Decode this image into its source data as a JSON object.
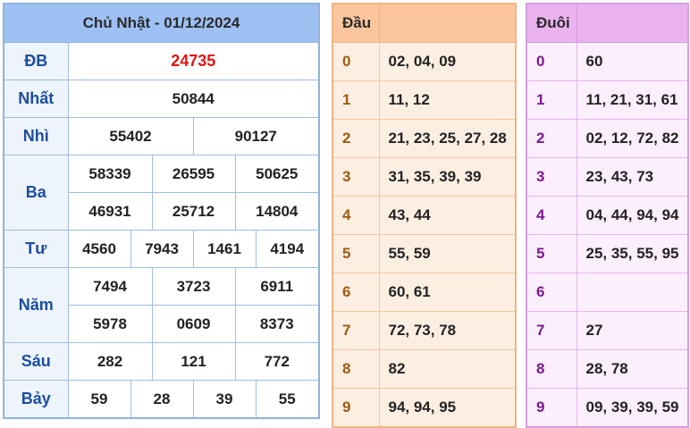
{
  "header": {
    "title": "Chủ Nhật - 01/12/2024"
  },
  "prizes": {
    "db": {
      "label": "ĐB",
      "values": [
        "24735"
      ]
    },
    "nhat": {
      "label": "Nhất",
      "values": [
        "50844"
      ]
    },
    "nhi": {
      "label": "Nhì",
      "values": [
        "55402",
        "90127"
      ]
    },
    "ba": {
      "label": "Ba",
      "values": [
        "58339",
        "26595",
        "50625",
        "46931",
        "25712",
        "14804"
      ]
    },
    "tu": {
      "label": "Tư",
      "values": [
        "4560",
        "7943",
        "1461",
        "4194"
      ]
    },
    "nam": {
      "label": "Năm",
      "values": [
        "7494",
        "3723",
        "6911",
        "5978",
        "0609",
        "8373"
      ]
    },
    "sau": {
      "label": "Sáu",
      "values": [
        "282",
        "121",
        "772"
      ]
    },
    "bay": {
      "label": "Bảy",
      "values": [
        "59",
        "28",
        "39",
        "55"
      ]
    }
  },
  "dau": {
    "title": "Đầu",
    "rows": [
      {
        "key": "0",
        "values": "02, 04, 09"
      },
      {
        "key": "1",
        "values": "11, 12"
      },
      {
        "key": "2",
        "values": "21, 23, 25, 27, 28"
      },
      {
        "key": "3",
        "values": "31, 35, 39, 39"
      },
      {
        "key": "4",
        "values": "43, 44"
      },
      {
        "key": "5",
        "values": "55, 59"
      },
      {
        "key": "6",
        "values": "60, 61"
      },
      {
        "key": "7",
        "values": "72, 73, 78"
      },
      {
        "key": "8",
        "values": "82"
      },
      {
        "key": "9",
        "values": "94, 94, 95"
      }
    ]
  },
  "duoi": {
    "title": "Đuôi",
    "rows": [
      {
        "key": "0",
        "values": "60"
      },
      {
        "key": "1",
        "values": "11, 21, 31, 61"
      },
      {
        "key": "2",
        "values": "02, 12, 72, 82"
      },
      {
        "key": "3",
        "values": "23, 43, 73"
      },
      {
        "key": "4",
        "values": "04, 44, 94, 94"
      },
      {
        "key": "5",
        "values": "25, 35, 55, 95"
      },
      {
        "key": "6",
        "values": ""
      },
      {
        "key": "7",
        "values": "27"
      },
      {
        "key": "8",
        "values": "28, 78"
      },
      {
        "key": "9",
        "values": "09, 39, 39, 59"
      }
    ]
  },
  "colors": {
    "special_prize": "#e11414",
    "label_text": "#1b4e9e",
    "header_blue": "#9ec0f3",
    "header_orange": "#fbc69d",
    "header_purple": "#e9b3f0"
  }
}
